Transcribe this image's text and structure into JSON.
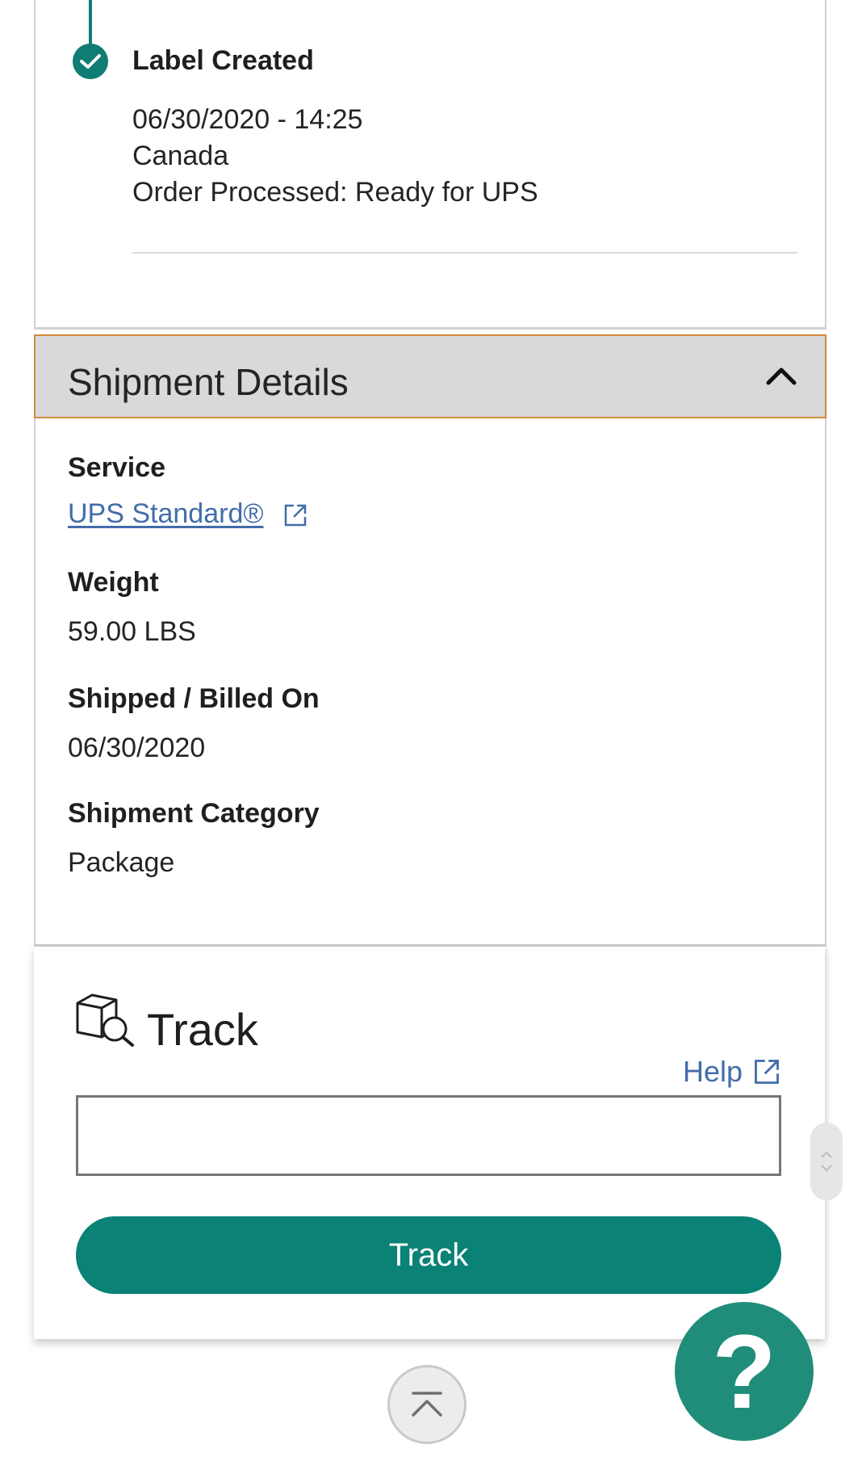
{
  "timeline": {
    "event": {
      "title": "Label Created",
      "datetime": "06/30/2020 - 14:25",
      "location": "Canada",
      "description": "Order Processed: Ready for UPS"
    },
    "accent_color": "#0f7d73"
  },
  "shipment_details": {
    "header": "Shipment Details",
    "fields": [
      {
        "label": "Service",
        "value": "UPS Standard®"
      },
      {
        "label": "Weight",
        "value": "59.00 LBS"
      },
      {
        "label": "Shipped / Billed On",
        "value": "06/30/2020"
      },
      {
        "label": "Shipment Category",
        "value": "Package"
      }
    ],
    "header_border_color": "#d38a3a"
  },
  "track": {
    "heading": "Track",
    "help_label": "Help",
    "input_value": "",
    "button_label": "Track",
    "button_color": "#0a8276"
  },
  "help_fab": {
    "symbol": "?"
  },
  "icons": {
    "check": "check-icon",
    "chevron": "chevron-up-icon",
    "external": "external-link-icon",
    "track": "package-search-icon",
    "back_to_top": "back-to-top-icon"
  }
}
